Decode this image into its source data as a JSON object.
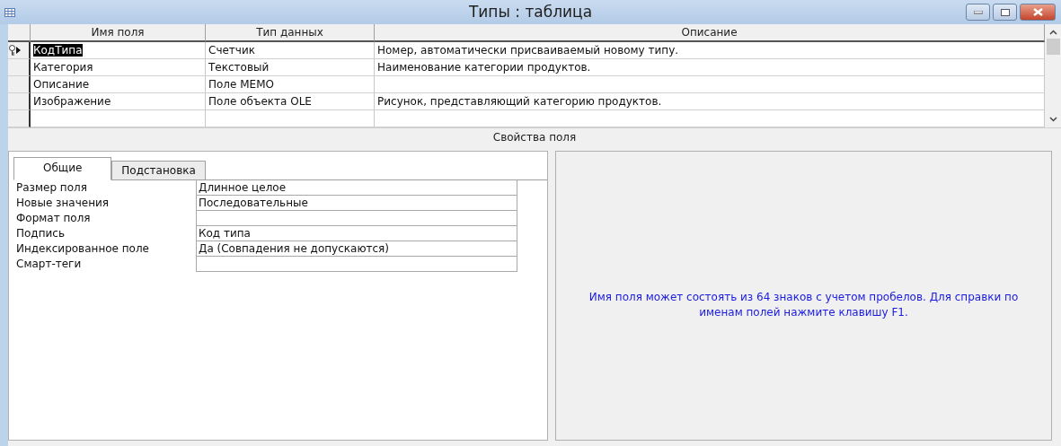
{
  "window": {
    "title": "Типы : таблица"
  },
  "grid": {
    "columns": [
      "Имя поля",
      "Тип данных",
      "Описание"
    ],
    "rows": [
      {
        "name": "КодТипа",
        "type": "Счетчик",
        "description": "Номер, автоматически присваиваемый новому типу.",
        "key": true,
        "selected": true
      },
      {
        "name": "Категория",
        "type": "Текстовый",
        "description": "Наименование категории продуктов.",
        "key": false,
        "selected": false
      },
      {
        "name": "Описание",
        "type": "Поле MEMO",
        "description": "",
        "key": false,
        "selected": false
      },
      {
        "name": "Изображение",
        "type": "Поле объекта OLE",
        "description": "Рисунок, представляющий категорию продуктов.",
        "key": false,
        "selected": false
      }
    ]
  },
  "properties": {
    "title": "Свойства поля",
    "tabs": [
      {
        "label": "Общие",
        "selected": true
      },
      {
        "label": "Подстановка",
        "selected": false
      }
    ],
    "rows": [
      {
        "label": "Размер поля",
        "value": "Длинное целое"
      },
      {
        "label": "Новые значения",
        "value": "Последовательные"
      },
      {
        "label": "Формат поля",
        "value": ""
      },
      {
        "label": "Подпись",
        "value": "Код типа"
      },
      {
        "label": "Индексированное поле",
        "value": "Да (Совпадения не допускаются)"
      },
      {
        "label": "Смарт-теги",
        "value": ""
      }
    ],
    "help": "Имя поля может состоять из 64 знаков с учетом пробелов.  Для справки по именам полей нажмите клавишу F1."
  }
}
